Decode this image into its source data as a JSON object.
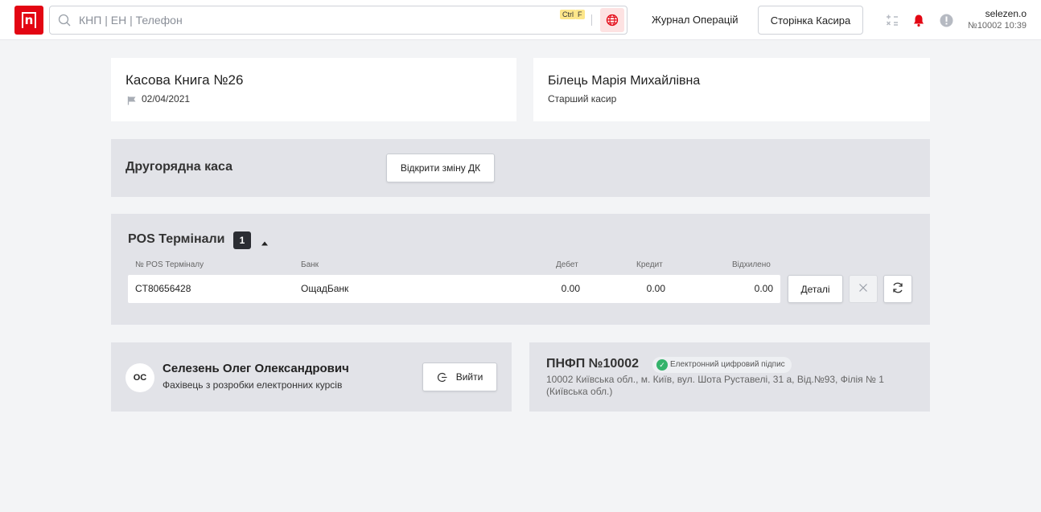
{
  "header": {
    "logo_letter": "n",
    "search_placeholder": "КНП | ЕН | Телефон",
    "search_shortcut": [
      "Ctrl",
      "F"
    ],
    "journal_label": "Журнал Операцій",
    "cashier_page_label": "Сторінка Касира",
    "user": {
      "login": "selezen.o",
      "meta": "№10002 10:39"
    },
    "accent_color": "#e30613"
  },
  "cash_book": {
    "title": "Касова Книга №26",
    "date": "02/04/2021"
  },
  "cashier": {
    "name": "Білець Марія Михайлівна",
    "role": "Старший касир"
  },
  "secondary_cash": {
    "title": "Другорядна каса",
    "open_button": "Відкрити зміну ДК"
  },
  "pos": {
    "title": "POS Термінали",
    "count": "1",
    "columns": {
      "terminal": "№ POS Терміналу",
      "bank": "Банк",
      "debit": "Дебет",
      "credit": "Кредит",
      "rejected": "Відхилено"
    },
    "rows": [
      {
        "terminal": "CT80656428",
        "bank": "ОщадБанк",
        "debit": "0.00",
        "credit": "0.00",
        "rejected": "0.00"
      }
    ],
    "details_button": "Деталі"
  },
  "employee": {
    "initials": "ОС",
    "name": "Селезень Олег Олександрович",
    "position": "Фахівець з розробки електронних курсів",
    "logout_button": "Вийти"
  },
  "branch": {
    "title": "ПНФП №10002",
    "signature_badge": "Електронний цифровий підпис",
    "address_line1": "10002 Київська обл., м. Київ, вул. Шота Руставелі, 31 а, Від.№93, Філія № 1",
    "address_line2": "(Київська обл.)"
  }
}
